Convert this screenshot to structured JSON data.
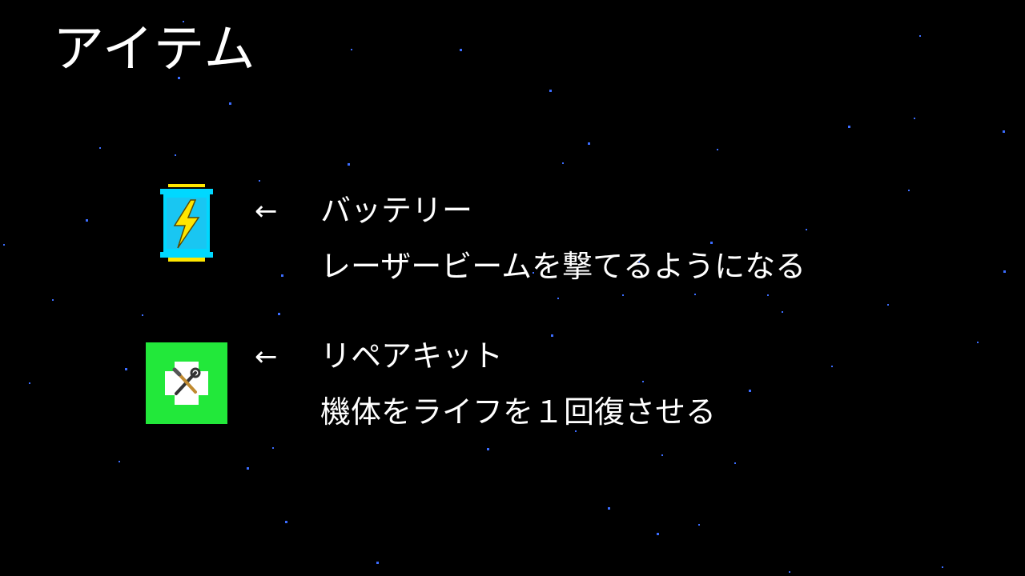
{
  "screen": {
    "title": "アイテム",
    "background_color": "#000000",
    "star_color": "#3b6cff"
  },
  "items": [
    {
      "icon": "battery-icon",
      "arrow": "←",
      "name": "バッテリー",
      "description": "レーザービームを撃てるようになる",
      "colors": {
        "body": "#00d8ff",
        "caps": "#ffe600",
        "bolt": "#ffe600"
      }
    },
    {
      "icon": "repair-kit-icon",
      "arrow": "←",
      "name": "リペアキット",
      "description": "機体をライフを１回復させる",
      "colors": {
        "box": "#22e83a",
        "cross": "#ffffff"
      }
    }
  ]
}
